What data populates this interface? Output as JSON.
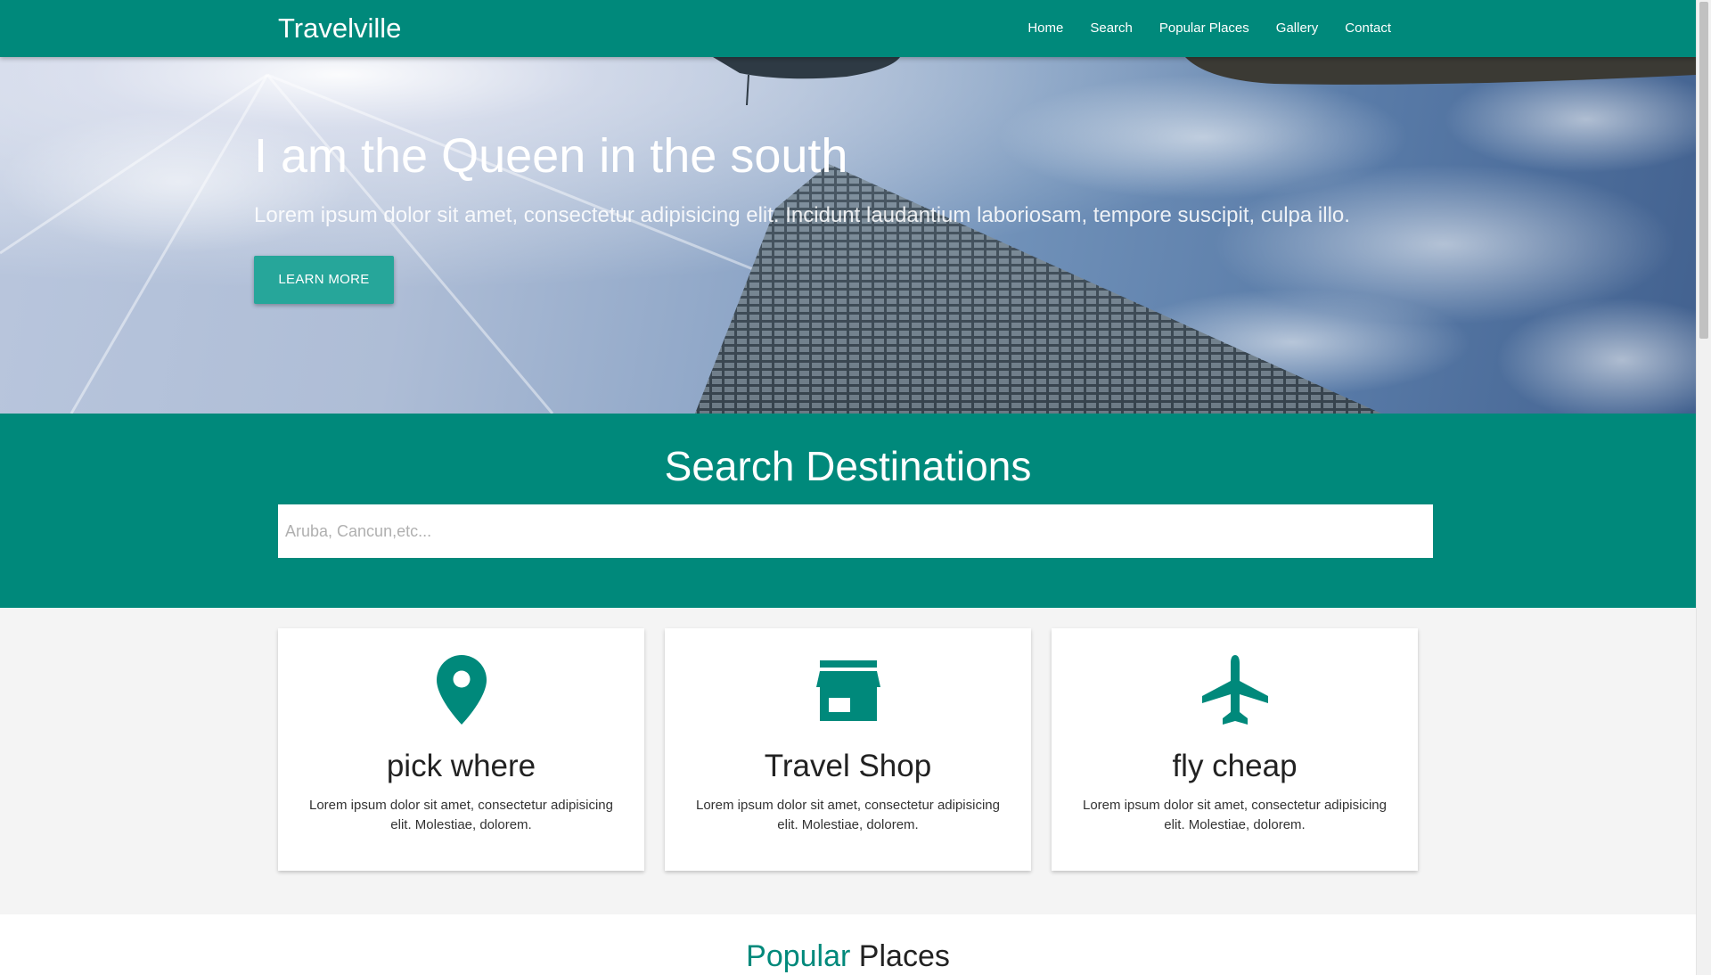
{
  "brand": "Travelville",
  "nav": {
    "items": [
      "Home",
      "Search",
      "Popular Places",
      "Gallery",
      "Contact"
    ]
  },
  "hero": {
    "title": "I am the Queen in the south",
    "subtitle": "Lorem ipsum dolor sit amet, consectetur adipisicing elit. Incidunt laudantium laboriosam, tempore suscipit, culpa illo.",
    "button": "LEARN MORE"
  },
  "search": {
    "title": "Search Destinations",
    "placeholder": "Aruba, Cancun,etc...",
    "value": ""
  },
  "features": [
    {
      "icon": "location-pin-icon",
      "title": "pick where",
      "text": "Lorem ipsum dolor sit amet, consectetur adipisicing elit. Molestiae, dolorem."
    },
    {
      "icon": "store-icon",
      "title": "Travel Shop",
      "text": "Lorem ipsum dolor sit amet, consectetur adipisicing elit. Molestiae, dolorem."
    },
    {
      "icon": "airplane-icon",
      "title": "fly cheap",
      "text": "Lorem ipsum dolor sit amet, consectetur adipisicing elit. Molestiae, dolorem."
    }
  ],
  "popular": {
    "title_accent": "Popular",
    "title_rest": "Places"
  },
  "colors": {
    "primary": "#00897b",
    "button": "#26a69a",
    "background": "#f4f4f4"
  }
}
